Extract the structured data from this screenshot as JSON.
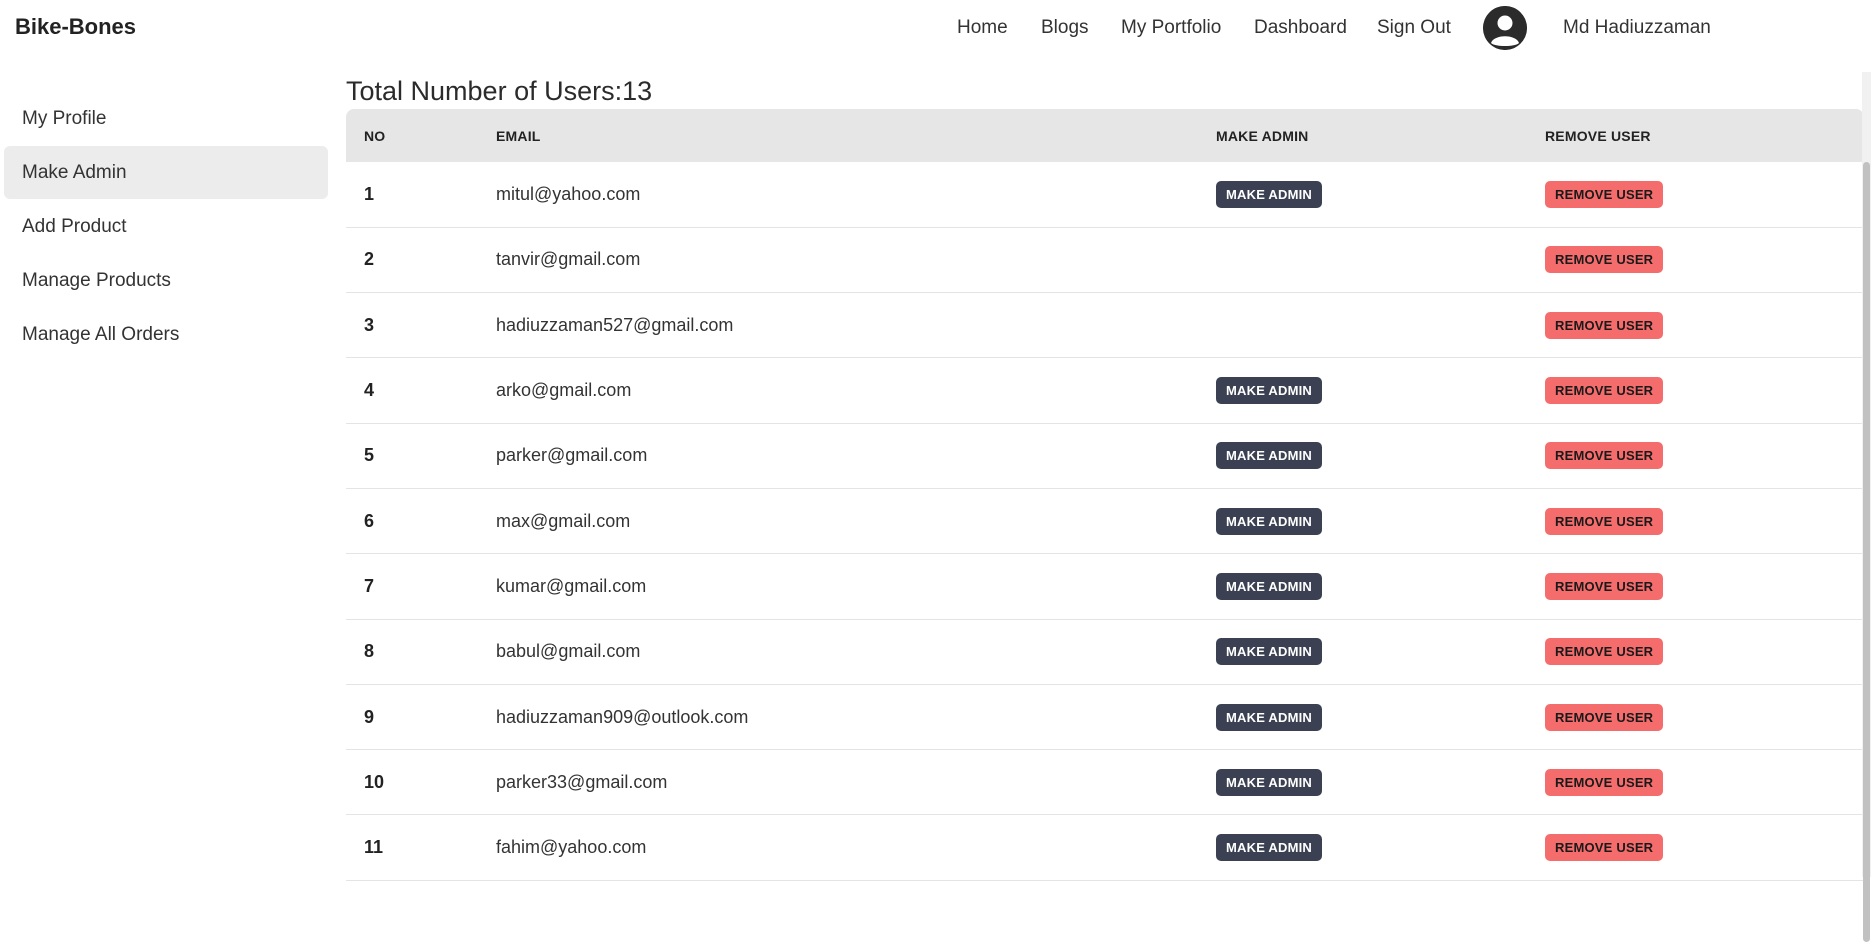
{
  "header": {
    "brand": "Bike-Bones",
    "nav": [
      {
        "label": "Home"
      },
      {
        "label": "Blogs"
      },
      {
        "label": "My Portfolio"
      },
      {
        "label": "Dashboard"
      },
      {
        "label": "Sign Out"
      }
    ],
    "avatar_icon": "user-circle-icon",
    "user_name": "Md Hadiuzzaman"
  },
  "sidebar": {
    "items": [
      {
        "label": "My Profile",
        "active": false
      },
      {
        "label": "Make Admin",
        "active": true
      },
      {
        "label": "Add Product",
        "active": false
      },
      {
        "label": "Manage Products",
        "active": false
      },
      {
        "label": "Manage All Orders",
        "active": false
      }
    ]
  },
  "main": {
    "title": "Total Number of Users:13",
    "columns": [
      "NO",
      "EMAIL",
      "MAKE ADMIN",
      "REMOVE USER"
    ],
    "make_admin_label": "MAKE ADMIN",
    "remove_user_label": "REMOVE USER",
    "rows": [
      {
        "no": "1",
        "email": "mitul@yahoo.com",
        "can_make_admin": true
      },
      {
        "no": "2",
        "email": "tanvir@gmail.com",
        "can_make_admin": false
      },
      {
        "no": "3",
        "email": "hadiuzzaman527@gmail.com",
        "can_make_admin": false
      },
      {
        "no": "4",
        "email": "arko@gmail.com",
        "can_make_admin": true
      },
      {
        "no": "5",
        "email": "parker@gmail.com",
        "can_make_admin": true
      },
      {
        "no": "6",
        "email": "max@gmail.com",
        "can_make_admin": true
      },
      {
        "no": "7",
        "email": "kumar@gmail.com",
        "can_make_admin": true
      },
      {
        "no": "8",
        "email": "babul@gmail.com",
        "can_make_admin": true
      },
      {
        "no": "9",
        "email": "hadiuzzaman909@outlook.com",
        "can_make_admin": true
      },
      {
        "no": "10",
        "email": "parker33@gmail.com",
        "can_make_admin": true
      },
      {
        "no": "11",
        "email": "fahim@yahoo.com",
        "can_make_admin": true
      }
    ]
  },
  "colors": {
    "make_admin_bg": "#3b4152",
    "remove_user_bg": "#f56c6c",
    "active_sidebar_bg": "#ececec",
    "table_header_bg": "#e6e6e6"
  }
}
